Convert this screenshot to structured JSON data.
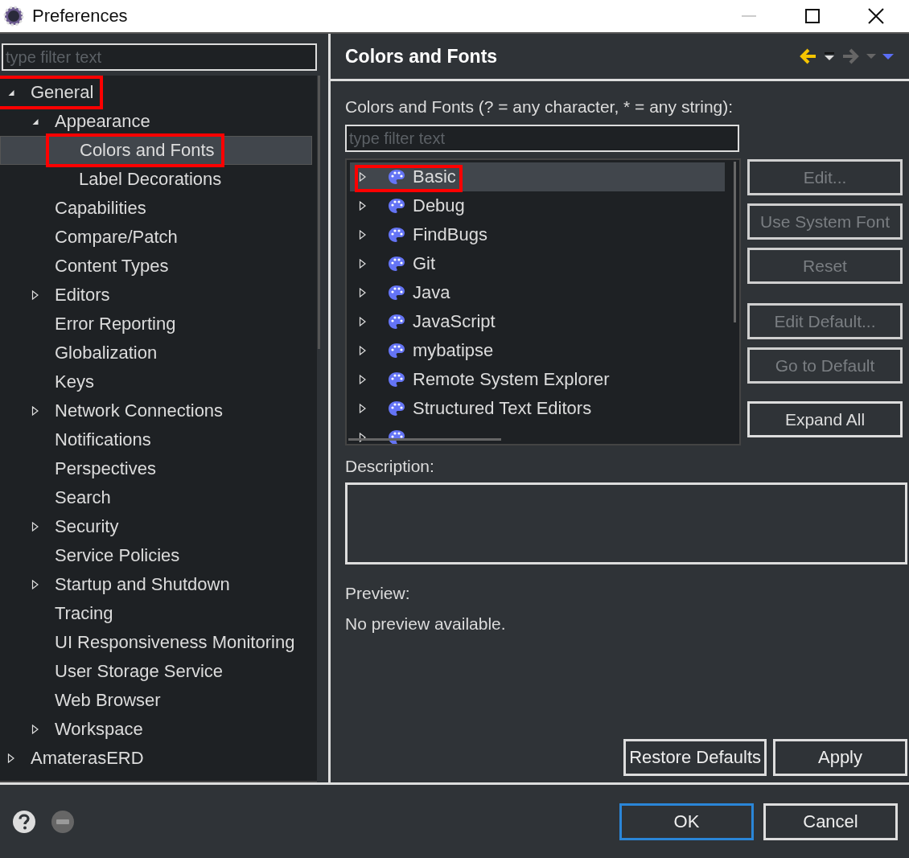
{
  "window": {
    "title": "Preferences"
  },
  "sidebar": {
    "filter": {
      "placeholder": "type filter text"
    },
    "tree": [
      {
        "label": "General",
        "expanded": true,
        "selected": false,
        "highlighted": true,
        "children": [
          {
            "label": "Appearance",
            "expanded": true,
            "selected": false,
            "highlighted": false,
            "children": [
              {
                "label": "Colors and Fonts",
                "selected": true,
                "highlighted": true
              },
              {
                "label": "Label Decorations",
                "selected": false,
                "highlighted": false
              }
            ]
          },
          {
            "label": "Capabilities",
            "selected": false,
            "highlighted": false
          },
          {
            "label": "Compare/Patch",
            "selected": false,
            "highlighted": false
          },
          {
            "label": "Content Types",
            "selected": false,
            "highlighted": false
          },
          {
            "label": "Editors",
            "expanded": false,
            "selected": false,
            "highlighted": false
          },
          {
            "label": "Error Reporting",
            "selected": false,
            "highlighted": false
          },
          {
            "label": "Globalization",
            "selected": false,
            "highlighted": false
          },
          {
            "label": "Keys",
            "selected": false,
            "highlighted": false
          },
          {
            "label": "Network Connections",
            "expanded": false,
            "selected": false,
            "highlighted": false
          },
          {
            "label": "Notifications",
            "selected": false,
            "highlighted": false
          },
          {
            "label": "Perspectives",
            "selected": false,
            "highlighted": false
          },
          {
            "label": "Search",
            "selected": false,
            "highlighted": false
          },
          {
            "label": "Security",
            "expanded": false,
            "selected": false,
            "highlighted": false
          },
          {
            "label": "Service Policies",
            "selected": false,
            "highlighted": false
          },
          {
            "label": "Startup and Shutdown",
            "expanded": false,
            "selected": false,
            "highlighted": false
          },
          {
            "label": "Tracing",
            "selected": false,
            "highlighted": false
          },
          {
            "label": "UI Responsiveness Monitoring",
            "selected": false,
            "highlighted": false
          },
          {
            "label": "User Storage Service",
            "selected": false,
            "highlighted": false
          },
          {
            "label": "Web Browser",
            "selected": false,
            "highlighted": false
          },
          {
            "label": "Workspace",
            "expanded": false,
            "selected": false,
            "highlighted": false
          }
        ]
      },
      {
        "label": "AmaterasERD",
        "expanded": false,
        "selected": false,
        "highlighted": false
      }
    ]
  },
  "page": {
    "title": "Colors and Fonts",
    "filter_label": "Colors and Fonts (? = any character, * = any string):",
    "filter": {
      "placeholder": "type filter text"
    },
    "categories": [
      {
        "label": "Basic",
        "expanded": false,
        "selected": true,
        "highlighted": true
      },
      {
        "label": "Debug",
        "expanded": false,
        "selected": false,
        "highlighted": false
      },
      {
        "label": "FindBugs",
        "expanded": false,
        "selected": false,
        "highlighted": false
      },
      {
        "label": "Git",
        "expanded": false,
        "selected": false,
        "highlighted": false
      },
      {
        "label": "Java",
        "expanded": false,
        "selected": false,
        "highlighted": false
      },
      {
        "label": "JavaScript",
        "expanded": false,
        "selected": false,
        "highlighted": false
      },
      {
        "label": "mybatipse",
        "expanded": false,
        "selected": false,
        "highlighted": false
      },
      {
        "label": "Remote System Explorer",
        "expanded": false,
        "selected": false,
        "highlighted": false
      },
      {
        "label": "Structured Text Editors",
        "expanded": false,
        "selected": false,
        "highlighted": false
      },
      {
        "expanded": false,
        "selected": false,
        "highlighted": false
      }
    ],
    "side_buttons": [
      {
        "label": "Edit...",
        "disabled": true
      },
      {
        "label": "Use System Font",
        "disabled": true
      },
      {
        "label": "Reset",
        "disabled": true
      },
      {
        "label": "Edit Default...",
        "disabled": true
      },
      {
        "label": "Go to Default",
        "disabled": true
      },
      {
        "label": "Expand All",
        "disabled": false
      }
    ],
    "description_label": "Description:",
    "preview_label": "Preview:",
    "preview_text": "No preview available.",
    "buttons": [
      {
        "label": "Restore Defaults"
      },
      {
        "label": "Apply"
      }
    ]
  },
  "dialog_buttons": [
    {
      "label": "OK",
      "default": true
    },
    {
      "label": "Cancel",
      "default": false
    }
  ]
}
